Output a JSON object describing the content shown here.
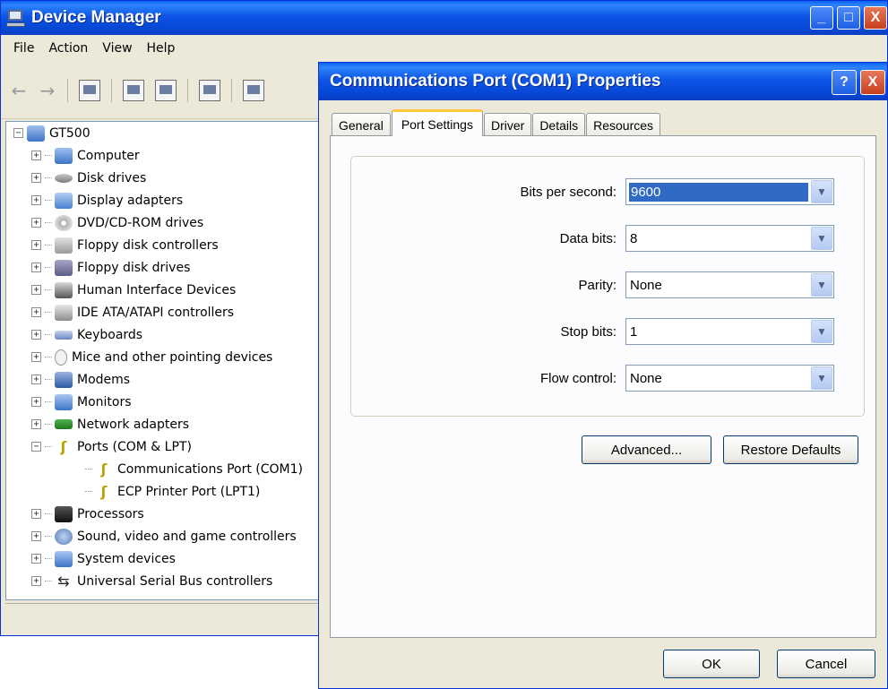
{
  "device_manager": {
    "title": "Device Manager",
    "window_controls": {
      "minimize": "_",
      "maximize": "□",
      "close": "X"
    },
    "menu": [
      "File",
      "Action",
      "View",
      "Help"
    ],
    "tree": {
      "root": "GT500",
      "items": [
        {
          "label": "Computer",
          "icon": "computer-icon",
          "expander": "+"
        },
        {
          "label": "Disk drives",
          "icon": "disk-drive-icon",
          "expander": "+"
        },
        {
          "label": "Display adapters",
          "icon": "display-adapter-icon",
          "expander": "+"
        },
        {
          "label": "DVD/CD-ROM drives",
          "icon": "dvd-icon",
          "expander": "+"
        },
        {
          "label": "Floppy disk controllers",
          "icon": "floppy-controller-icon",
          "expander": "+"
        },
        {
          "label": "Floppy disk drives",
          "icon": "floppy-drive-icon",
          "expander": "+"
        },
        {
          "label": "Human Interface Devices",
          "icon": "hid-icon",
          "expander": "+"
        },
        {
          "label": "IDE ATA/ATAPI controllers",
          "icon": "ide-icon",
          "expander": "+"
        },
        {
          "label": "Keyboards",
          "icon": "keyboard-icon",
          "expander": "+"
        },
        {
          "label": "Mice and other pointing devices",
          "icon": "mouse-icon",
          "expander": "+"
        },
        {
          "label": "Modems",
          "icon": "modem-icon",
          "expander": "+"
        },
        {
          "label": "Monitors",
          "icon": "monitor-icon",
          "expander": "+"
        },
        {
          "label": "Network adapters",
          "icon": "network-adapter-icon",
          "expander": "+"
        },
        {
          "label": "Ports (COM & LPT)",
          "icon": "port-icon",
          "expander": "−"
        },
        {
          "label": "Communications Port (COM1)",
          "icon": "port-icon",
          "child": true
        },
        {
          "label": "ECP Printer Port (LPT1)",
          "icon": "port-icon",
          "child": true
        },
        {
          "label": "Processors",
          "icon": "processor-icon",
          "expander": "+"
        },
        {
          "label": "Sound, video and game controllers",
          "icon": "sound-icon",
          "expander": "+"
        },
        {
          "label": "System devices",
          "icon": "system-devices-icon",
          "expander": "+"
        },
        {
          "label": "Universal Serial Bus controllers",
          "icon": "usb-icon",
          "expander": "+"
        }
      ]
    }
  },
  "dialog": {
    "title": "Communications Port (COM1) Properties",
    "help": "?",
    "close": "X",
    "tabs": [
      "General",
      "Port Settings",
      "Driver",
      "Details",
      "Resources"
    ],
    "active_tab": "Port Settings",
    "fields": [
      {
        "label": "Bits per second:",
        "value": "9600",
        "selected": true
      },
      {
        "label": "Data bits:",
        "value": "8"
      },
      {
        "label": "Parity:",
        "value": "None"
      },
      {
        "label": "Stop bits:",
        "value": "1"
      },
      {
        "label": "Flow control:",
        "value": "None"
      }
    ],
    "buttons": {
      "advanced": "Advanced...",
      "restore": "Restore Defaults",
      "ok": "OK",
      "cancel": "Cancel"
    }
  }
}
